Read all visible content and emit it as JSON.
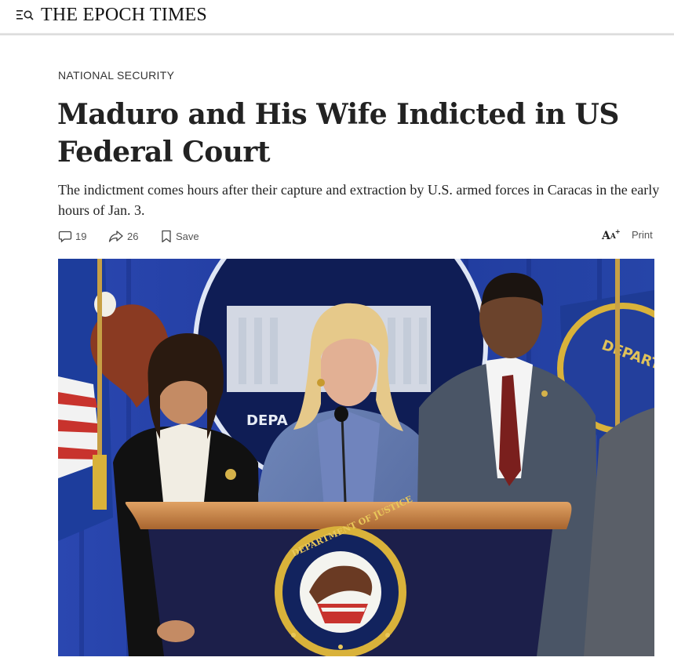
{
  "header": {
    "masthead": "THE EPOCH TIMES",
    "menu_icon": "menu-search-icon"
  },
  "article": {
    "section": "NATIONAL SECURITY",
    "headline": "Maduro and His Wife Indicted in US Federal Court",
    "subhead": "The indictment comes hours after their capture and extraction by U.S. armed forces in Caracas in the early hours of Jan. 3."
  },
  "actions": {
    "comments_count": "19",
    "shares_count": "26",
    "save_label": "Save",
    "font_icon": "text-size-icon",
    "print_label": "Print"
  },
  "photo": {
    "seal_text": "DEPARTMENT OF JUSTICE",
    "backdrop_text": "DEPA",
    "flag_text": "DEPART",
    "colors": {
      "backdrop_blue": "#1f3a9a",
      "podium_wood": "#c98a4e",
      "podium_front": "#1c1f4a",
      "seal_gold": "#d9b23a"
    }
  }
}
